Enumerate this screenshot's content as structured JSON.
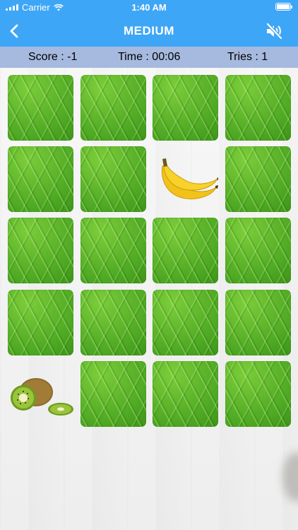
{
  "status_bar": {
    "carrier": "Carrier",
    "time": "1:40 AM"
  },
  "header": {
    "title": "MEDIUM"
  },
  "stats": {
    "score": "Score : -1",
    "time": "Time : 00:06",
    "tries": "Tries : 1"
  },
  "colors": {
    "nav": "#3ea6f7",
    "stats_bar": "#a6b9de",
    "leaf_green": "#5bb22b"
  },
  "board": {
    "rows": 5,
    "cols": 4,
    "cards": [
      "hidden",
      "hidden",
      "hidden",
      "hidden",
      "hidden",
      "hidden",
      "banana",
      "hidden",
      "hidden",
      "hidden",
      "hidden",
      "hidden",
      "hidden",
      "hidden",
      "hidden",
      "hidden",
      "kiwi",
      "hidden",
      "hidden",
      "hidden"
    ]
  }
}
